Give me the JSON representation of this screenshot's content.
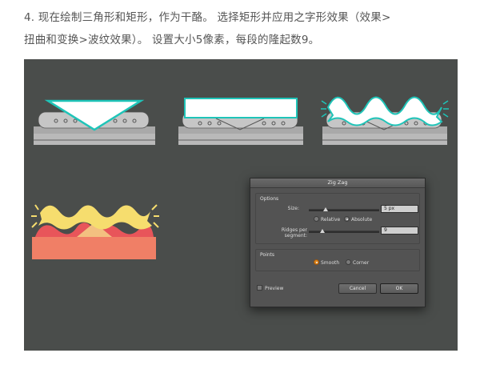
{
  "caption": {
    "line1": "4. 现在绘制三角形和矩形，作为干酪。 选择矩形并应用之字形效果（效果>",
    "line2": "扭曲和变换>波纹效果）。 设置大小5像素，每段的隆起数9。"
  },
  "colors": {
    "canvas_bg": "#4a4d4b",
    "cheese_white": "#ffffff",
    "selection_teal": "#1fc4b8",
    "bread_gray": "#c7c7c7",
    "cheese_yellow": "#f6dd6e",
    "tomato_red": "#e8555a",
    "base_salmon": "#f07f66"
  },
  "dialog": {
    "title": "Zig Zag",
    "options_label": "Options",
    "size_label": "Size:",
    "size_value": "5 px",
    "relative_label": "Relative",
    "absolute_label": "Absolute",
    "ridges_label": "Ridges per segment:",
    "ridges_value": "9",
    "points_label": "Points",
    "smooth_label": "Smooth",
    "corner_label": "Corner",
    "preview_label": "Preview",
    "cancel_label": "Cancel",
    "ok_label": "OK"
  }
}
